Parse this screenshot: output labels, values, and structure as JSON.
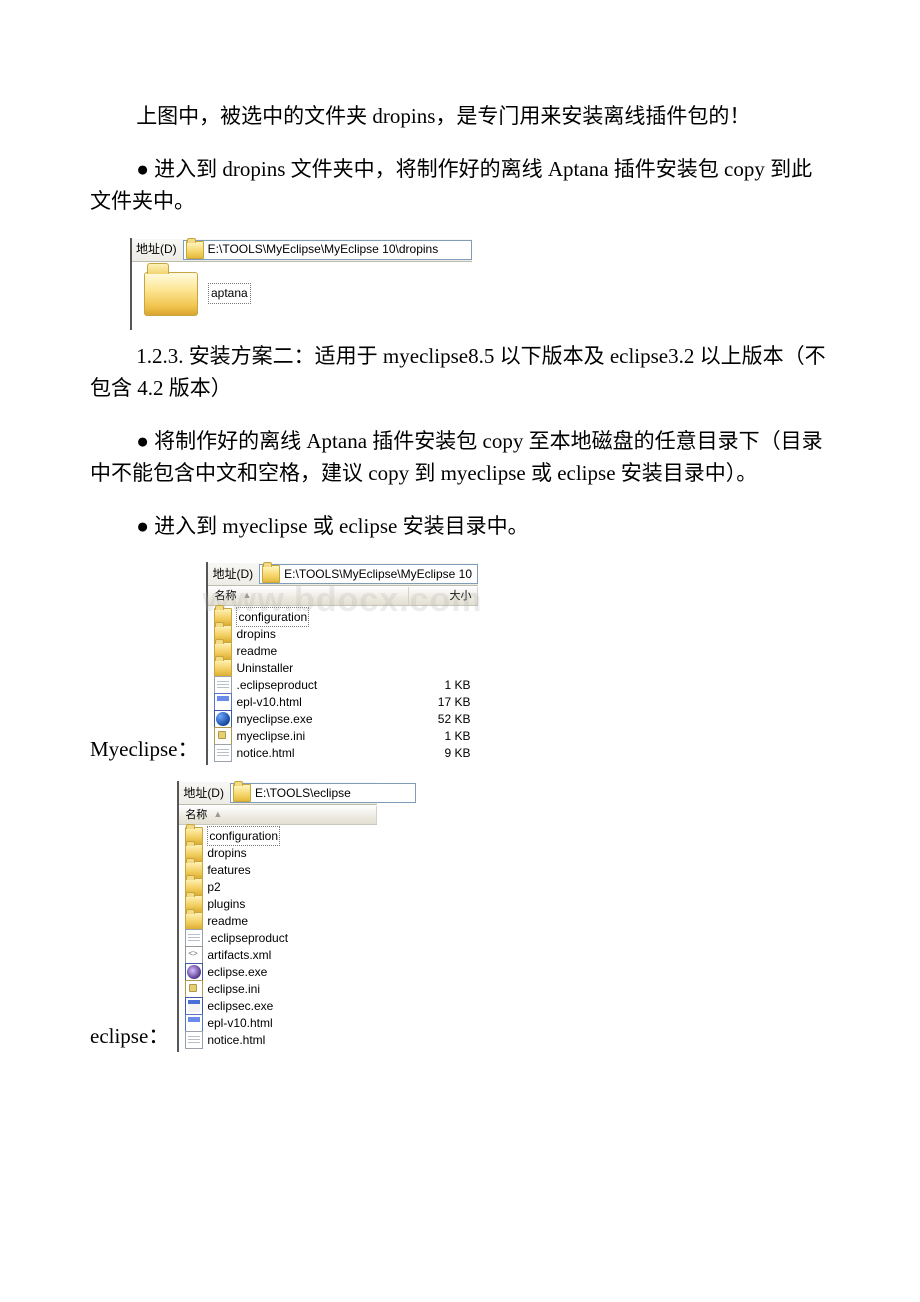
{
  "paragraphs": {
    "p1": "上图中，被选中的文件夹 dropins，是专门用来安装离线插件包的！",
    "p2": "● 进入到 dropins 文件夹中，将制作好的离线 Aptana 插件安装包 copy 到此文件夹中。",
    "p3": "1.2.3. 安装方案二：适用于 myeclipse8.5 以下版本及 eclipse3.2 以上版本（不包含 4.2 版本）",
    "p4": "● 将制作好的离线 Aptana 插件安装包 copy 至本地磁盘的任意目录下（目录中不能包含中文和空格，建议 copy 到 myeclipse 或 eclipse 安装目录中）。",
    "p5": "● 进入到 myeclipse 或 eclipse 安装目录中。"
  },
  "labels": {
    "address": "地址(D)",
    "col_name": "名称",
    "col_size": "大小",
    "myeclipse_caption": "Myeclipse：",
    "eclipse_caption": "eclipse："
  },
  "explorer1": {
    "path": "E:\\TOOLS\\MyEclipse\\MyEclipse 10\\dropins",
    "folder_label": "aptana"
  },
  "explorer2": {
    "path": "E:\\TOOLS\\MyEclipse\\MyEclipse 10",
    "items": [
      {
        "name": "configuration",
        "type": "folder",
        "size": "",
        "selected": true
      },
      {
        "name": "dropins",
        "type": "folder",
        "size": ""
      },
      {
        "name": "readme",
        "type": "folder",
        "size": ""
      },
      {
        "name": "Uninstaller",
        "type": "folder",
        "size": ""
      },
      {
        "name": ".eclipseproduct",
        "type": "generic",
        "size": "1 KB"
      },
      {
        "name": "epl-v10.html",
        "type": "html",
        "size": "17 KB"
      },
      {
        "name": "myeclipse.exe",
        "type": "exe-blue",
        "size": "52 KB"
      },
      {
        "name": "myeclipse.ini",
        "type": "ini",
        "size": "1 KB"
      },
      {
        "name": "notice.html",
        "type": "generic",
        "size": "9 KB"
      }
    ]
  },
  "explorer3": {
    "path": "E:\\TOOLS\\eclipse",
    "items": [
      {
        "name": "configuration",
        "type": "folder",
        "size": "",
        "selected": true
      },
      {
        "name": "dropins",
        "type": "folder",
        "size": ""
      },
      {
        "name": "features",
        "type": "folder",
        "size": ""
      },
      {
        "name": "p2",
        "type": "folder",
        "size": ""
      },
      {
        "name": "plugins",
        "type": "folder",
        "size": ""
      },
      {
        "name": "readme",
        "type": "folder",
        "size": ""
      },
      {
        "name": ".eclipseproduct",
        "type": "generic",
        "size": ""
      },
      {
        "name": "artifacts.xml",
        "type": "xml",
        "size": ""
      },
      {
        "name": "eclipse.exe",
        "type": "exe-eclipse",
        "size": ""
      },
      {
        "name": "eclipse.ini",
        "type": "ini",
        "size": ""
      },
      {
        "name": "eclipsec.exe",
        "type": "exe-plain",
        "size": ""
      },
      {
        "name": "epl-v10.html",
        "type": "html",
        "size": ""
      },
      {
        "name": "notice.html",
        "type": "generic",
        "size": ""
      }
    ]
  },
  "watermark": "www.bdocx.com"
}
